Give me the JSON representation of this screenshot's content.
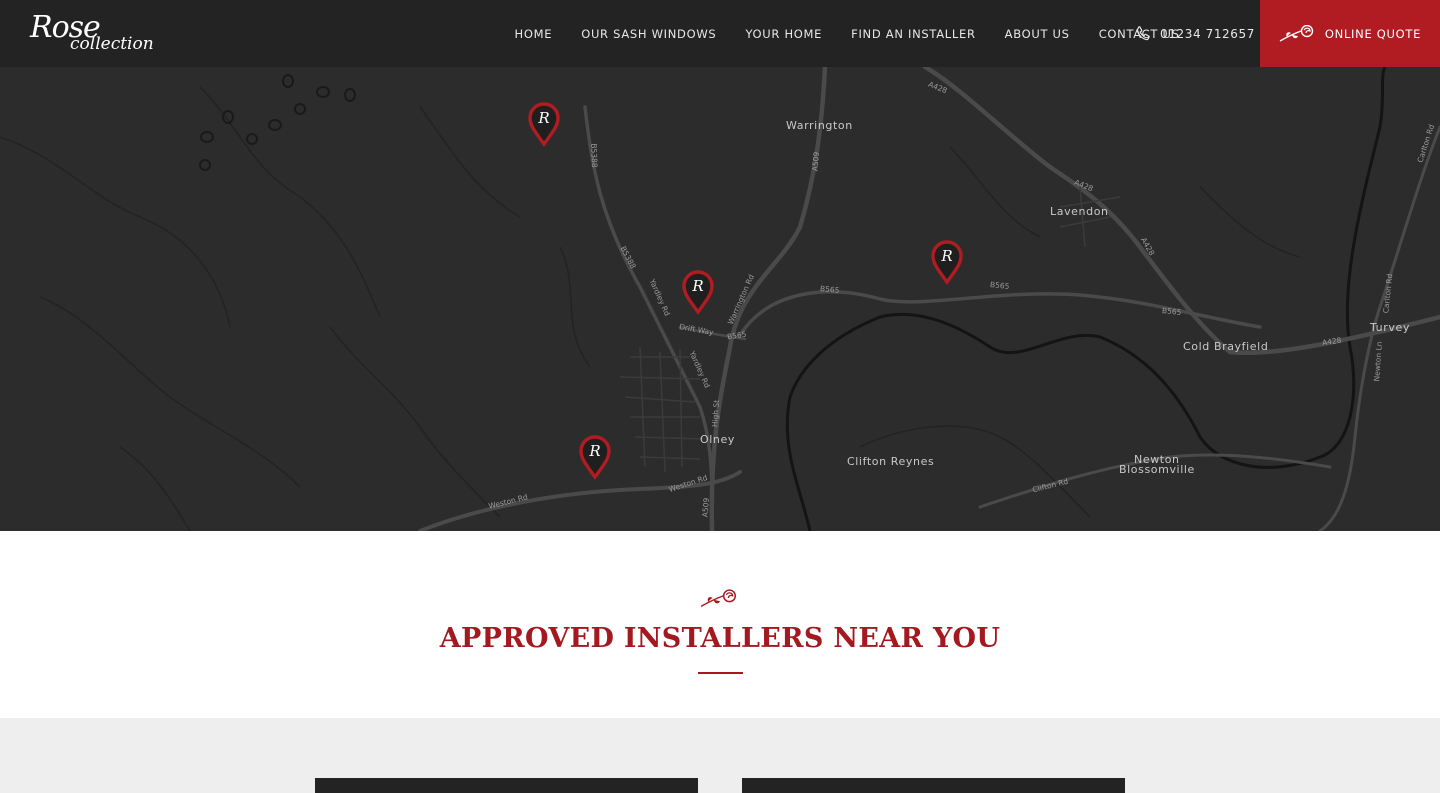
{
  "header": {
    "logo_line1": "Rose",
    "logo_line2": "collection",
    "nav": [
      {
        "label": "HOME"
      },
      {
        "label": "OUR SASH WINDOWS"
      },
      {
        "label": "YOUR HOME"
      },
      {
        "label": "FIND AN INSTALLER"
      },
      {
        "label": "ABOUT US"
      },
      {
        "label": "CONTACT US"
      }
    ],
    "phone": "01234 712657",
    "quote_label": "ONLINE QUOTE"
  },
  "map": {
    "places": [
      "Warrington",
      "Lavendon",
      "Olney",
      "Clifton Reynes",
      "Cold Brayfield",
      "Turvey",
      "Newton",
      "Blossomville"
    ],
    "roads": [
      "A428",
      "A428",
      "A428",
      "A428",
      "B5388",
      "B5388",
      "A509",
      "A509",
      "B565",
      "B565",
      "B565",
      "B565",
      "Warrington Rd",
      "Yardley Rd",
      "Yardley Rd",
      "Drift Way",
      "High St",
      "Weston Rd",
      "Weston Rd",
      "Clifton Rd",
      "Carlton Rd",
      "Carlton Rd",
      "Newton Ln"
    ],
    "pin_letter": "R"
  },
  "section": {
    "title": "APPROVED INSTALLERS NEAR YOU"
  },
  "colors": {
    "header_bg": "#232323",
    "accent": "#b01c22",
    "title": "#a3191f",
    "map_bg": "#2c2c2c"
  }
}
